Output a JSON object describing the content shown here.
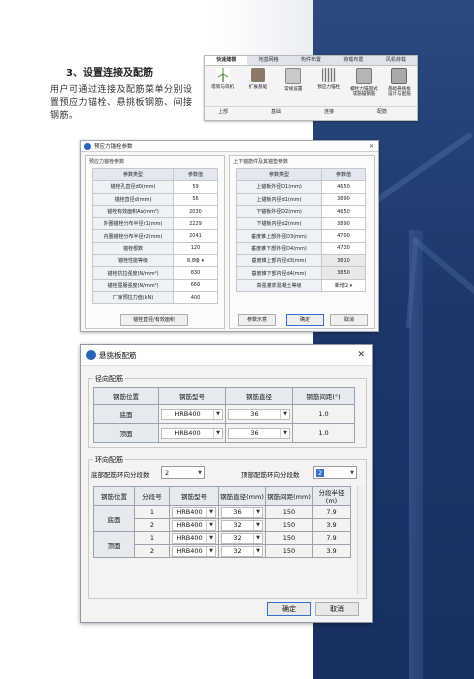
{
  "section": {
    "heading": "3、设置连接及配筋",
    "paragraph": "用户可通过连接及配筋菜单分别设置预应力锚栓、悬挑板钢筋、间接钢筋。"
  },
  "ribbon": {
    "tabs": [
      "快速建模",
      "地基网格",
      "构件布置",
      "荷载布置",
      "风机荷载"
    ],
    "active_tab": 0,
    "buttons": [
      "塔筒与风机",
      "扩展基础",
      "常规设置",
      "预应力锚栓",
      "螺栓力锚固式\n或筋锚钢筋",
      "基础悬挑板\n设计与配筋"
    ],
    "groups": [
      "上部",
      "基础",
      "连接",
      "配筋"
    ]
  },
  "anchor_dialog": {
    "title": "预应力锚栓参数",
    "left_panel_title": "预应力锚栓参数",
    "right_panel_title": "上下锚筋件及其锚垫参数",
    "col_param": "参数类型",
    "col_value": "参数值",
    "left_rows": [
      {
        "label": "锚栓孔直径d0(mm)",
        "value": "59"
      },
      {
        "label": "锚栓直径d(mm)",
        "value": "56"
      },
      {
        "label": "锚栓有效面积As(mm²)",
        "value": "2030"
      },
      {
        "label": "外圈锚栓分布半径r1(mm)",
        "value": "2229"
      },
      {
        "label": "内圈锚栓分布半径r2(mm)",
        "value": "2041"
      },
      {
        "label": "锚栓根数",
        "value": "120"
      },
      {
        "label": "锚栓性能等级",
        "value": "8.8级"
      },
      {
        "label": "锚栓抗拉强度(N/mm²)",
        "value": "830"
      },
      {
        "label": "锚栓屈服强度(N/mm²)",
        "value": "660"
      },
      {
        "label": "厂家预拉力值(kN)",
        "value": "400"
      }
    ],
    "right_rows": [
      {
        "label": "上锚板外径D1(mm)",
        "value": "4650"
      },
      {
        "label": "上锚板内径d1(mm)",
        "value": "3890"
      },
      {
        "label": "下锚板外径D2(mm)",
        "value": "4650"
      },
      {
        "label": "下锚板内径d2(mm)",
        "value": "3890"
      },
      {
        "label": "垂度锥上部外径D3(mm)",
        "value": "4700"
      },
      {
        "label": "垂度锥下部外径D4(mm)",
        "value": "4730"
      },
      {
        "label": "垂度锥上部内径d3(mm)",
        "value": "3810"
      },
      {
        "label": "垂度锥下部内径d4(mm)",
        "value": "3850"
      },
      {
        "label": "高强灌浆混凝土等级",
        "value": "新增2"
      }
    ],
    "btn_bolt": "锚栓直径/有效面积",
    "btn_params": "参数示意",
    "btn_ok": "确定",
    "btn_cancel": "取消"
  },
  "cantilever_dialog": {
    "title": "悬挑板配筋",
    "radial": {
      "legend": "径向配筋",
      "headers": [
        "钢筋位置",
        "钢筋型号",
        "钢筋直径",
        "钢筋间距(°)"
      ],
      "rows": [
        {
          "pos": "底面",
          "type": "HRB400",
          "dia": "36",
          "spacing": "1.0"
        },
        {
          "pos": "顶面",
          "type": "HRB400",
          "dia": "36",
          "spacing": "1.0"
        }
      ]
    },
    "ring": {
      "legend": "环向配筋",
      "bottom_label": "底部配筋环向分段数",
      "bottom_value": "2",
      "top_label": "顶部配筋环向分段数",
      "top_value": "2",
      "headers": [
        "钢筋位置",
        "分段号",
        "钢筋型号",
        "钢筋直径(mm)",
        "钢筋间距(mm)",
        "分段半径(m)"
      ],
      "groups": [
        {
          "pos": "底面",
          "rows": [
            {
              "seg": "1",
              "type": "HRB400",
              "dia": "36",
              "spacing": "150",
              "radius": "7.9"
            },
            {
              "seg": "2",
              "type": "HRB400",
              "dia": "32",
              "spacing": "150",
              "radius": "3.9"
            }
          ]
        },
        {
          "pos": "顶面",
          "rows": [
            {
              "seg": "1",
              "type": "HRB400",
              "dia": "32",
              "spacing": "150",
              "radius": "7.9"
            },
            {
              "seg": "2",
              "type": "HRB400",
              "dia": "32",
              "spacing": "150",
              "radius": "3.9"
            }
          ]
        }
      ]
    },
    "btn_ok": "确定",
    "btn_cancel": "取消"
  },
  "colors": {
    "navy": "#1f3a6a",
    "accent": "#2f6fcf"
  }
}
